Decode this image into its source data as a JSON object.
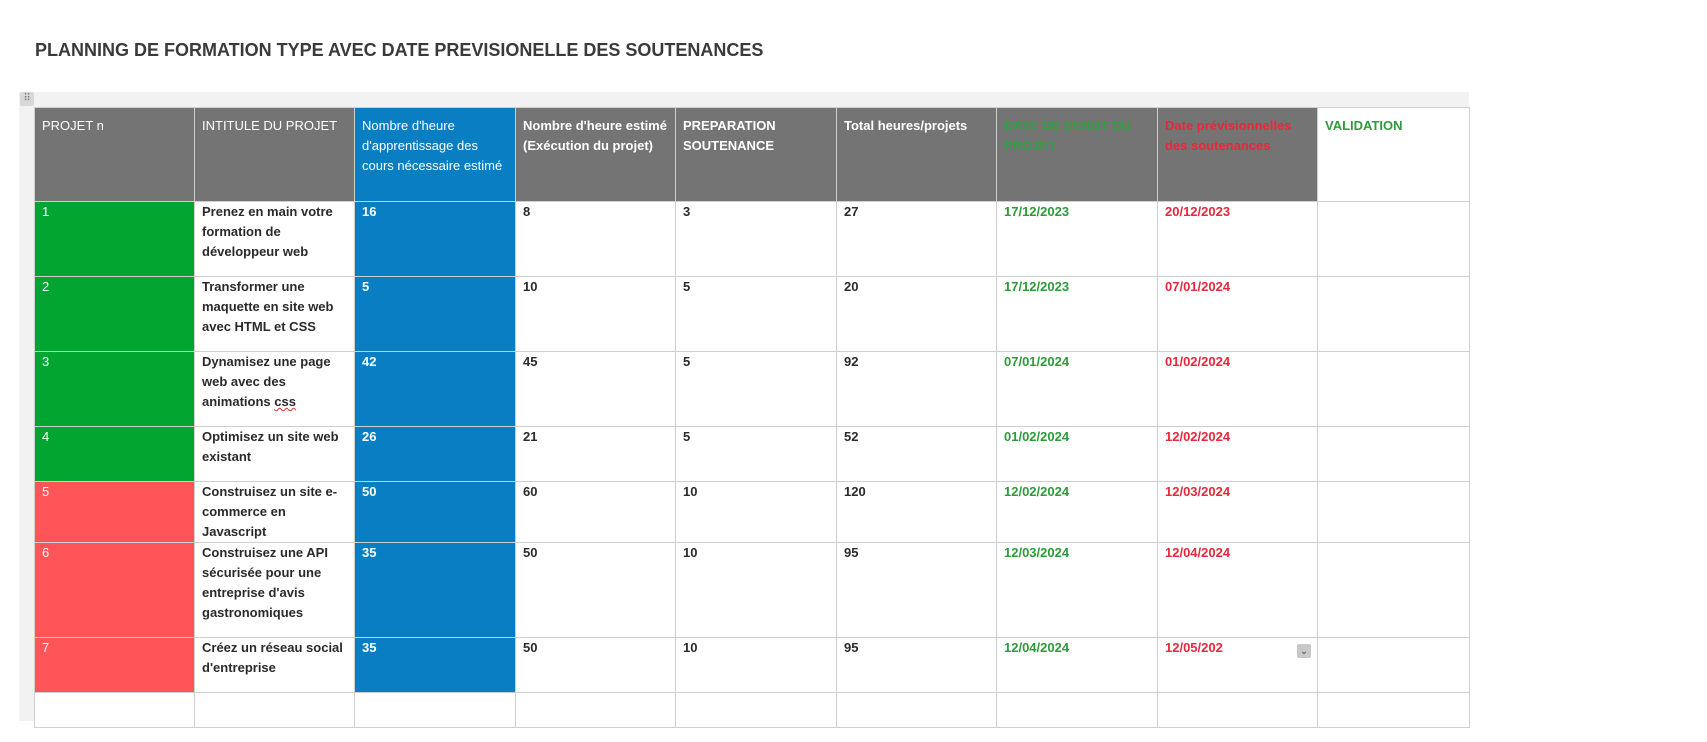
{
  "title": "PLANNING DE FORMATION TYPE AVEC DATE PREVISIONELLE DES SOUTENANCES",
  "handle_icon": "grid-handle-icon",
  "columns": {
    "projet": "PROJET n",
    "intitule": "INTITULE DU PROJET",
    "hours_learning": "Nombre d'heure d'apprentissage des cours nécessaire estimé",
    "hours_exec": "Nombre d'heure estimé (Exécution du projet)",
    "prep": "PREPARATION SOUTENANCE",
    "total": "Total heures/projets",
    "start": "DATE DE DEBUT DU PROJET",
    "prev": "Date prévisionnelles des soutenances",
    "validation": "VALIDATION"
  },
  "colors": {
    "header_gray": "#747474",
    "blue": "#0a7ec2",
    "green_cell": "#02a52f",
    "red_cell": "#ff5558",
    "green_text": "#2e9a3a",
    "red_text": "#e8273a"
  },
  "rows": [
    {
      "n": "1",
      "title": "Prenez en main votre formation de développeur web",
      "hours": "16",
      "exec": "8",
      "prep": "3",
      "total": "27",
      "start": "17/12/2023",
      "prev": "20/12/2023",
      "validation": ""
    },
    {
      "n": "2",
      "title": "Transformer une maquette en site web avec HTML et CSS",
      "hours": "5",
      "exec": "10",
      "prep": "5",
      "total": "20",
      "start": "17/12/2023",
      "prev": "07/01/2024",
      "validation": ""
    },
    {
      "n": "3",
      "title_a": "Dynamisez une page web avec des animations ",
      "title_b": "css",
      "hours": "42",
      "exec": "45",
      "prep": "5",
      "total": "92",
      "start": "07/01/2024",
      "prev": "01/02/2024",
      "validation": ""
    },
    {
      "n": "4",
      "title": "Optimisez un site web existant",
      "hours": "26",
      "exec": "21",
      "prep": "5",
      "total": "52",
      "start": "01/02/2024",
      "prev": "12/02/2024",
      "validation": ""
    },
    {
      "n": "5",
      "title": "Construisez un site e-commerce en Javascript",
      "hours": "50",
      "exec": "60",
      "prep": "10",
      "total": "120",
      "start": "12/02/2024",
      "prev": "12/03/2024",
      "validation": ""
    },
    {
      "n": "6",
      "title": "Construisez une API sécurisée pour une entreprise d'avis gastronomiques",
      "hours": "35",
      "exec": "50",
      "prep": "10",
      "total": "95",
      "start": "12/03/2024",
      "prev": "12/04/2024",
      "validation": ""
    },
    {
      "n": "7",
      "title": "Créez un réseau social d'entreprise",
      "hours": "35",
      "exec": "50",
      "prep": "10",
      "total": "95",
      "start": "12/04/2024",
      "prev": "12/05/202",
      "validation": "",
      "dropdown_icon": "chevron-down-icon"
    }
  ]
}
